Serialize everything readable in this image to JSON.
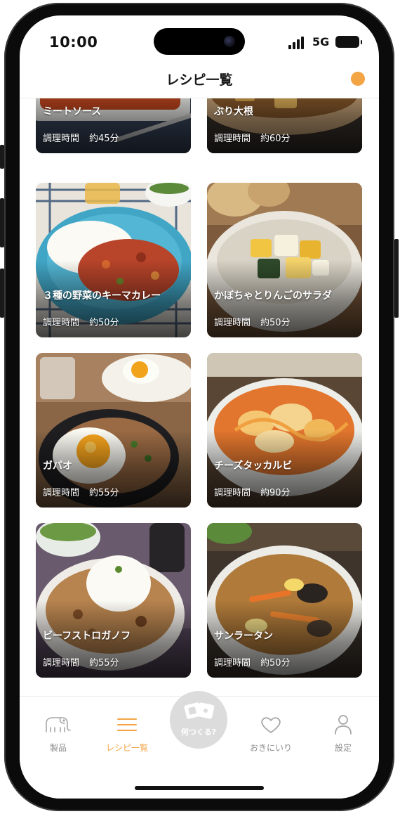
{
  "status": {
    "time": "10:00",
    "network": "5G"
  },
  "header": {
    "title": "レシピ一覧"
  },
  "recipes": [
    {
      "name": "ミートソース",
      "time_label": "調理時間",
      "time_value": "約45分"
    },
    {
      "name": "ぶり大根",
      "time_label": "調理時間",
      "time_value": "約60分"
    },
    {
      "name": "３種の野菜のキーマカレー",
      "time_label": "調理時間",
      "time_value": "約50分"
    },
    {
      "name": "かぼちゃとりんごのサラダ",
      "time_label": "調理時間",
      "time_value": "約50分"
    },
    {
      "name": "ガパオ",
      "time_label": "調理時間",
      "time_value": "約55分"
    },
    {
      "name": "チーズタッカルビ",
      "time_label": "調理時間",
      "time_value": "約90分"
    },
    {
      "name": "ビーフストロガノフ",
      "time_label": "調理時間",
      "time_value": "約55分"
    },
    {
      "name": "サンラータン",
      "time_label": "調理時間",
      "time_value": "約50分"
    }
  ],
  "tabbar": {
    "products": {
      "label": "製品",
      "icon": "elephant-icon"
    },
    "recipes": {
      "label": "レシピ一覧",
      "icon": "menu-icon"
    },
    "whattomake": {
      "label": "何つくる?",
      "icon": "cards-icon"
    },
    "favorites": {
      "label": "おきにいり",
      "icon": "heart-icon"
    },
    "settings": {
      "label": "設定",
      "icon": "person-icon"
    }
  },
  "colors": {
    "accent": "#f3a444",
    "inactive": "#8c8c8c",
    "fab": "#dcdcdc"
  }
}
